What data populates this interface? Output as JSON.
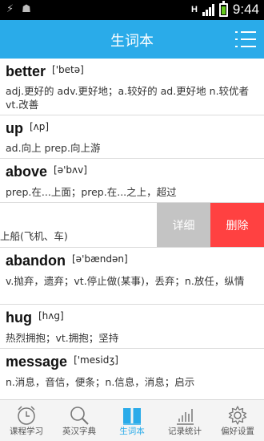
{
  "status_bar": {
    "time": "9:44",
    "network": "H"
  },
  "header": {
    "title": "生词本",
    "menu_icon": "list-menu-icon"
  },
  "words": [
    {
      "word": "better",
      "phonetic": "['betə]",
      "definition": "adj.更好的 adv.更好地；a.较好的 ad.更好地 n.较优者 vt.改善"
    },
    {
      "word": "up",
      "phonetic": "[ʌp]",
      "definition": "ad.向上 prep.向上游"
    },
    {
      "word": "above",
      "phonetic": "[ə'bʌv]",
      "definition": "prep.在...上面；prep.在...之上，超过"
    },
    {
      "word": "",
      "phonetic": "",
      "definition": "上船(飞机、车)"
    },
    {
      "word": "abandon",
      "phonetic": "[ə'bændən]",
      "definition": "v.抛弃，遗弃；vt.停止做(某事)，丢弃；n.放任，纵情"
    },
    {
      "word": "hug",
      "phonetic": "[hʌg]",
      "definition": "热烈拥抱；vt.拥抱；坚持"
    },
    {
      "word": "message",
      "phonetic": "['mesidʒ]",
      "definition": "n.消息，音信，便条；n.信息，消息；启示"
    }
  ],
  "swipe_actions": {
    "detail_label": "详细",
    "delete_label": "删除"
  },
  "tabs": [
    {
      "label": "课程学习",
      "icon": "alarm-clock-icon",
      "active": false
    },
    {
      "label": "英汉字典",
      "icon": "search-icon",
      "active": false
    },
    {
      "label": "生词本",
      "icon": "book-icon",
      "active": true
    },
    {
      "label": "记录统计",
      "icon": "bar-chart-icon",
      "active": false
    },
    {
      "label": "偏好设置",
      "icon": "gear-icon",
      "active": false
    }
  ],
  "colors": {
    "accent": "#2aabe9",
    "delete": "#ff4141",
    "detail": "#c4c4c4"
  }
}
